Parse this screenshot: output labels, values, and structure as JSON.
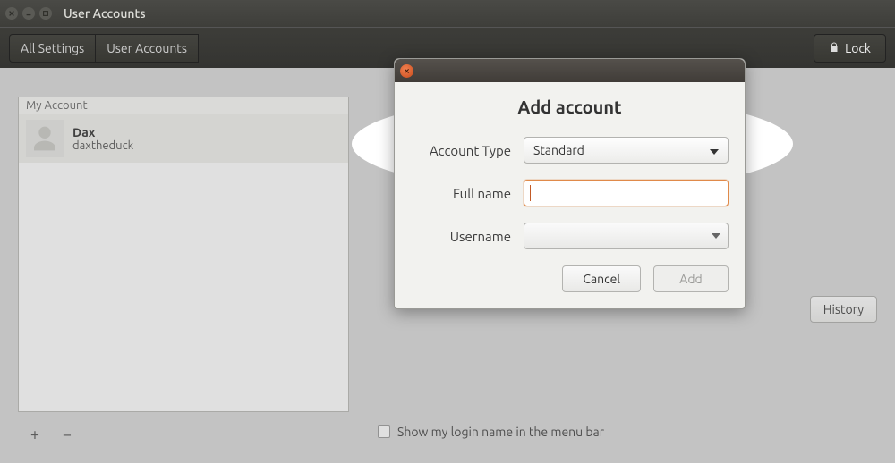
{
  "titlebar": {
    "title": "User Accounts"
  },
  "toolbar": {
    "all_settings_label": "All Settings",
    "current_label": "User Accounts",
    "lock_label": "Lock"
  },
  "sidebar": {
    "header": "My Account",
    "account": {
      "display_name": "Dax",
      "username": "daxtheduck"
    },
    "add_symbol": "+",
    "remove_symbol": "−"
  },
  "right": {
    "history_label": "History",
    "menu_bar_checkbox_label": "Show my login name in the menu bar"
  },
  "dialog": {
    "heading": "Add account",
    "labels": {
      "account_type": "Account Type",
      "full_name": "Full name",
      "username": "Username"
    },
    "account_type_value": "Standard",
    "full_name_value": "",
    "username_value": "",
    "cancel_label": "Cancel",
    "add_label": "Add"
  }
}
